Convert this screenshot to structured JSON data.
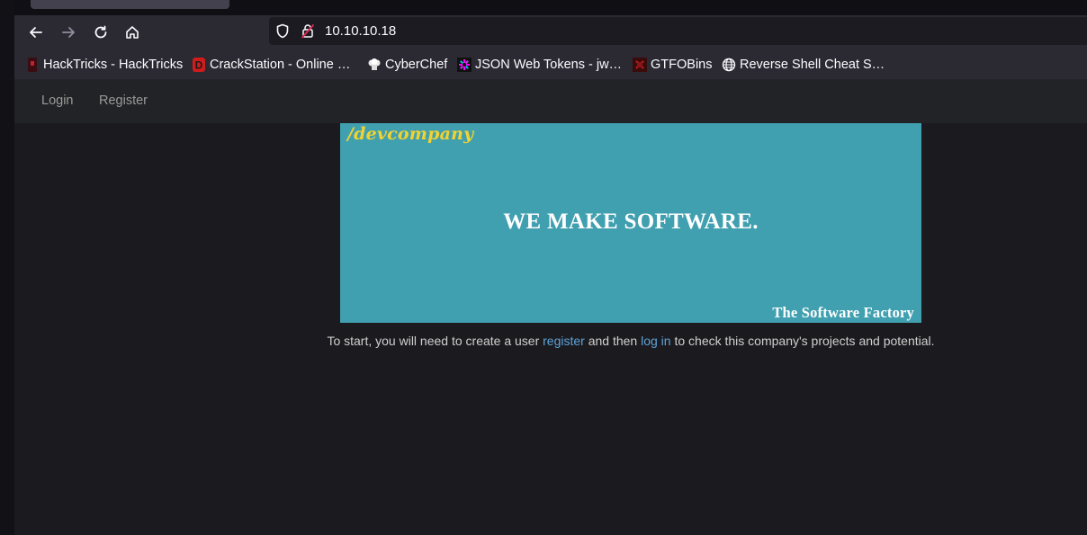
{
  "browser": {
    "url": "10.10.10.18",
    "bookmarks": [
      {
        "label": "HackTricks - HackTricks",
        "icon": "hacktricks-icon"
      },
      {
        "label": "CrackStation - Online …",
        "icon": "crackstation-icon"
      },
      {
        "label": "CyberChef",
        "icon": "cyberchef-icon"
      },
      {
        "label": "JSON Web Tokens - jw…",
        "icon": "jwt-icon"
      },
      {
        "label": "GTFOBins",
        "icon": "gtfobins-icon"
      },
      {
        "label": "Reverse Shell Cheat S…",
        "icon": "globe-icon"
      }
    ]
  },
  "site": {
    "nav": {
      "login": "Login",
      "register": "Register"
    },
    "banner": {
      "brand": "/devcompany",
      "headline": "WE MAKE SOFTWARE.",
      "tagline": "The Software Factory",
      "background": "#41a0b0",
      "brand_color": "#f2d32f"
    },
    "intro": {
      "before": "To start, you will need to create a user ",
      "register_link": "register",
      "middle": " and then ",
      "login_link": "log in",
      "after": " to check this company's projects and potential."
    },
    "link_color": "#5ea2d8"
  }
}
